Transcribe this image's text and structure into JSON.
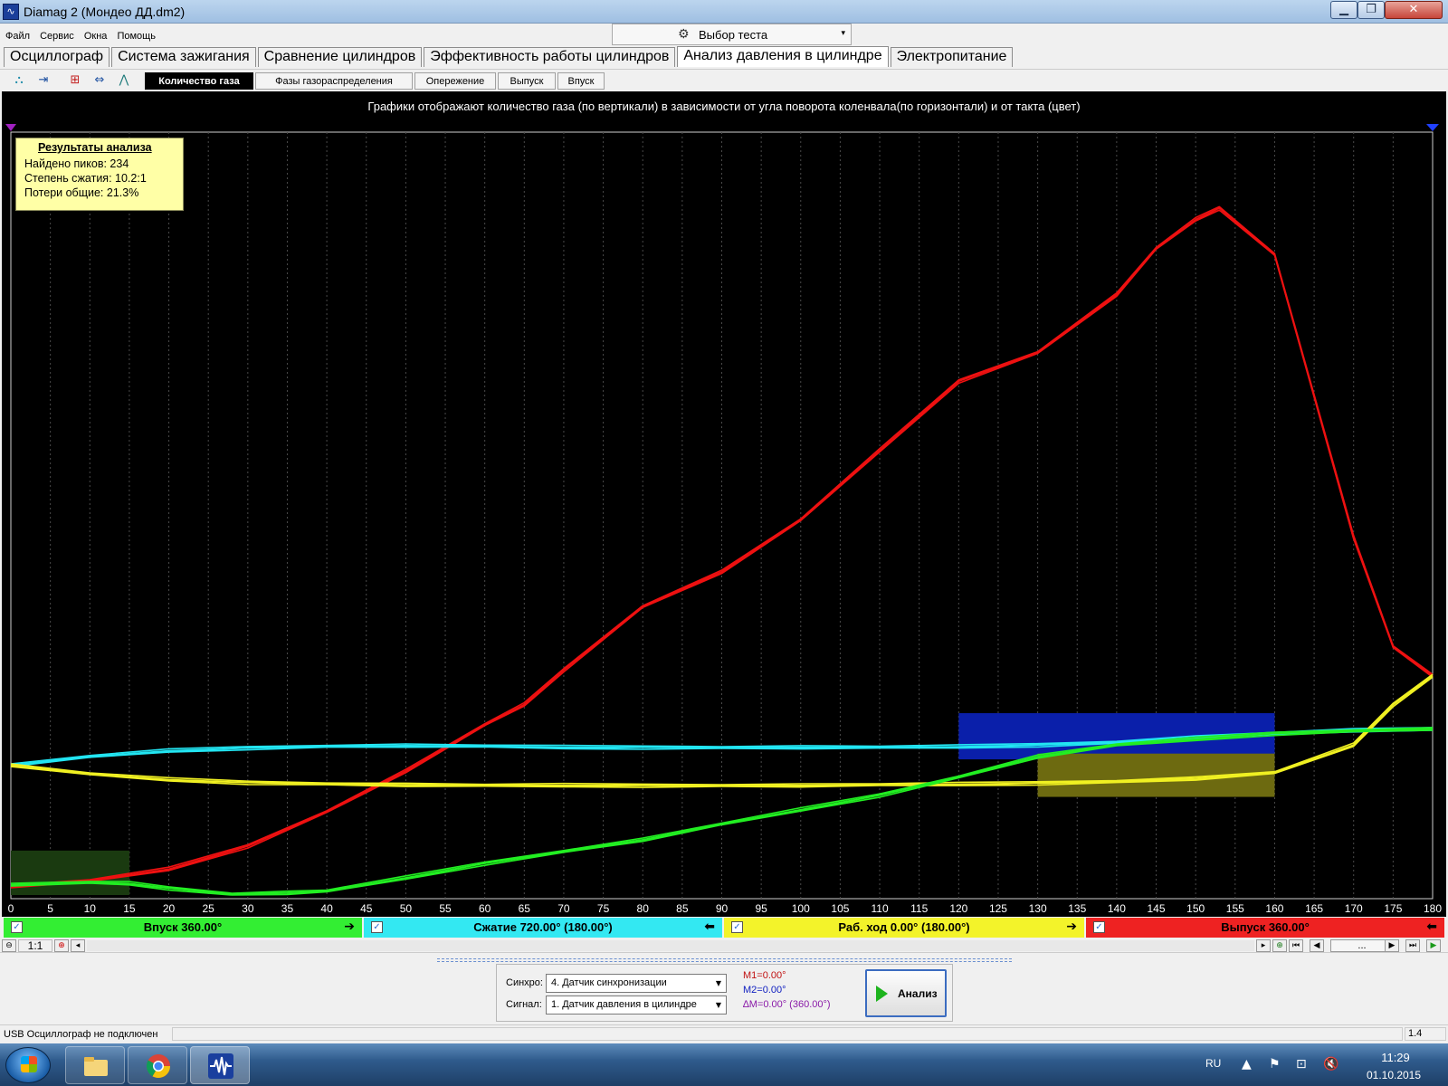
{
  "window": {
    "title": "Diamag 2 (Мондео ДД.dm2)",
    "min_glyph": "▁",
    "max_glyph": "❐",
    "close_glyph": "✕"
  },
  "menu": {
    "items": [
      "Файл",
      "Сервис",
      "Окна",
      "Помощь"
    ]
  },
  "test_select": {
    "label": "Выбор теста",
    "icon": "gear-icon",
    "arrow": "▾"
  },
  "main_tabs": [
    {
      "label": "Осциллограф",
      "active": false
    },
    {
      "label": "Система зажигания",
      "active": false
    },
    {
      "label": "Сравнение цилиндров",
      "active": false
    },
    {
      "label": "Эффективность работы цилиндров",
      "active": false
    },
    {
      "label": "Анализ давления в цилиндре",
      "active": true
    },
    {
      "label": "Электропитание",
      "active": false
    }
  ],
  "toolbar_icons": [
    "network-icon",
    "scale-icon",
    "markers-icon",
    "auto-scale-icon",
    "waveform-icon"
  ],
  "sub_tabs": [
    {
      "label": "Количество газа",
      "active": true
    },
    {
      "label": "Фазы газораспределения",
      "active": false
    },
    {
      "label": "Опережение",
      "active": false
    },
    {
      "label": "Выпуск",
      "active": false
    },
    {
      "label": "Впуск",
      "active": false
    }
  ],
  "plot": {
    "caption": "Графики отображают количество газа (по вертикали) в зависимости от угла поворота коленвала(по горизонтали) и от такта (цвет)"
  },
  "results": {
    "title": "Результаты анализа",
    "lines": [
      "Найдено пиков: 234",
      "Степень сжатия: 10.2:1",
      "Потери общие: 21.3%"
    ]
  },
  "chart_data": {
    "type": "line",
    "title": "",
    "xlabel": "",
    "ylabel": "",
    "xlim": [
      0,
      180
    ],
    "ylim": [
      0,
      100
    ],
    "x_ticks": [
      0,
      5,
      10,
      15,
      20,
      25,
      30,
      35,
      40,
      45,
      50,
      55,
      60,
      65,
      70,
      75,
      80,
      85,
      90,
      95,
      100,
      105,
      110,
      115,
      120,
      125,
      130,
      135,
      140,
      145,
      150,
      155,
      160,
      165,
      170,
      175,
      180
    ],
    "grid": "vertical-dashed",
    "colors": {
      "intake": "#22ee22",
      "compression": "#22e5f2",
      "power": "#f0f022",
      "exhaust": "#ee1111"
    },
    "series": [
      {
        "name": "Выпуск",
        "color": "#ee1111",
        "x": [
          0,
          10,
          20,
          30,
          40,
          50,
          60,
          65,
          70,
          80,
          90,
          100,
          110,
          120,
          130,
          140,
          145,
          150,
          153,
          160,
          170,
          175,
          180
        ],
        "y": [
          1.5,
          2.5,
          4.5,
          8.5,
          14.5,
          21.5,
          29.5,
          33,
          39,
          50,
          56,
          65,
          77,
          89,
          94,
          104,
          112,
          117,
          119,
          111,
          62,
          43,
          38
        ]
      },
      {
        "name": "Сжатие",
        "color": "#22e5f2",
        "x": [
          0,
          10,
          20,
          30,
          40,
          50,
          60,
          70,
          80,
          90,
          100,
          110,
          120,
          130,
          140,
          150,
          160,
          170,
          180
        ],
        "y": [
          22.5,
          24,
          25,
          25.5,
          25.8,
          25.9,
          25.8,
          25.6,
          25.6,
          25.6,
          25.6,
          25.6,
          25.7,
          26,
          26.5,
          27.3,
          28,
          28.5,
          28.8
        ]
      },
      {
        "name": "Раб. ход",
        "color": "#f0f022",
        "x": [
          0,
          10,
          20,
          30,
          40,
          50,
          60,
          70,
          80,
          90,
          100,
          110,
          120,
          130,
          140,
          150,
          160,
          170,
          175,
          180
        ],
        "y": [
          22.5,
          21,
          20,
          19.5,
          19.3,
          19.1,
          19,
          19,
          19,
          19,
          19,
          19.1,
          19.2,
          19.4,
          19.7,
          20.2,
          21.2,
          26,
          33,
          38
        ]
      },
      {
        "name": "Впуск",
        "color": "#22ee22",
        "x": [
          0,
          10,
          15,
          20,
          28,
          35,
          40,
          50,
          60,
          70,
          80,
          90,
          100,
          110,
          120,
          130,
          140,
          150,
          160,
          170,
          180
        ],
        "y": [
          1.8,
          2.2,
          2,
          1.2,
          0.2,
          0.4,
          0.7,
          3,
          5.5,
          7.6,
          9.6,
          12.3,
          14.8,
          17.3,
          20.5,
          24,
          26,
          27,
          28,
          28.5,
          28.8
        ]
      }
    ],
    "marker_rects": [
      {
        "color": "#1a3a10",
        "x0": 0,
        "x1": 15,
        "y0": 0,
        "y1": 7.7
      },
      {
        "color": "#0a1faa",
        "x0": 120,
        "x1": 160,
        "y0": 23.5,
        "y1": 31.5
      },
      {
        "color": "#6d6a10",
        "x0": 130,
        "x1": 160,
        "y0": 17,
        "y1": 24.5
      }
    ]
  },
  "phases": [
    {
      "label": "Впуск 360.00°",
      "color": "#33ee33",
      "arrow": "➔"
    },
    {
      "label": "Сжатие 720.00° (180.00°)",
      "color": "#33e8f2",
      "arrow": "⬅"
    },
    {
      "label": "Раб. ход 0.00° (180.00°)",
      "color": "#f3f32a",
      "arrow": "➔"
    },
    {
      "label": "Выпуск 360.00°",
      "color": "#ee2222",
      "arrow": "⬅"
    }
  ],
  "scroll": {
    "zoom": "1:1",
    "nav_label": "..."
  },
  "controls": {
    "sync_label": "Синхро:",
    "sync_value": "4.  Датчик синхронизации",
    "signal_label": "Сигнал:",
    "signal_value": "1.  Датчик давления в цилиндре",
    "m1": "M1=0.00°",
    "m2": "M2=0.00°",
    "dm": "∆M=0.00° (360.00°)",
    "analyze": "Анализ"
  },
  "status": {
    "text": "USB Осциллограф не подключен",
    "version": "1.4"
  },
  "taskbar": {
    "lang": "RU",
    "time": "11:29",
    "date": "01.10.2015"
  }
}
